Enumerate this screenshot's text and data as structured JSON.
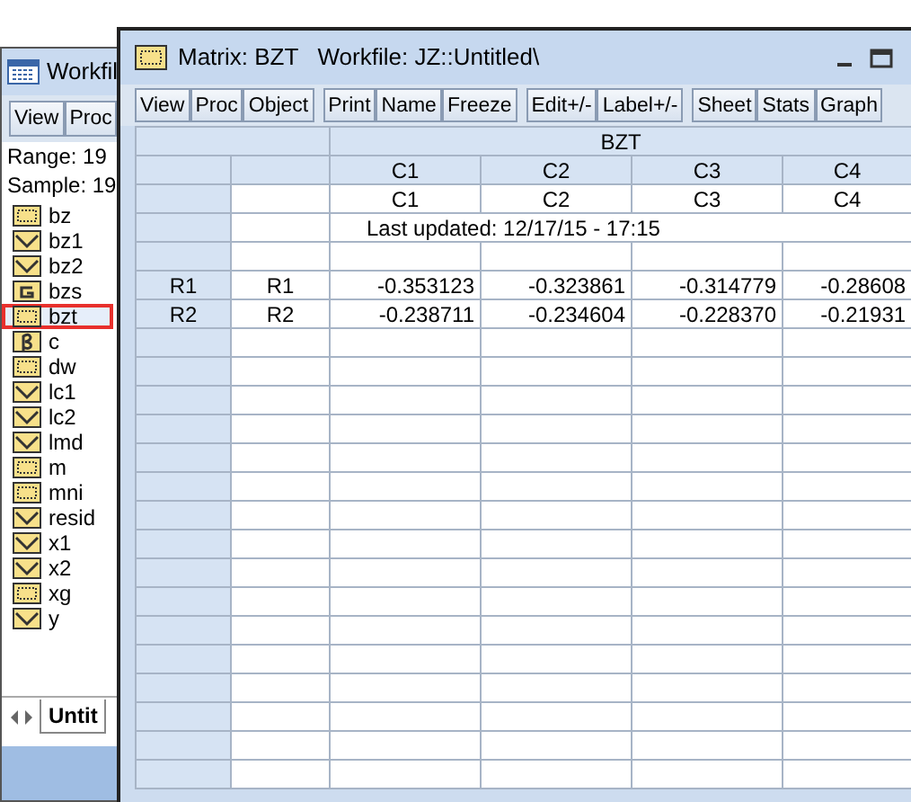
{
  "workfile_window": {
    "title": "Workfil",
    "toolbar": [
      "View",
      "Proc"
    ],
    "range": "Range:  19",
    "sample": "Sample: 19",
    "objects": [
      {
        "name": "bz",
        "kind": "matrix",
        "selected": false
      },
      {
        "name": "bz1",
        "kind": "series",
        "selected": false
      },
      {
        "name": "bz2",
        "kind": "series",
        "selected": false
      },
      {
        "name": "bzs",
        "kind": "group",
        "selected": false
      },
      {
        "name": "bzt",
        "kind": "matrix",
        "selected": true
      },
      {
        "name": "c",
        "kind": "coef",
        "selected": false
      },
      {
        "name": "dw",
        "kind": "matrix",
        "selected": false
      },
      {
        "name": "lc1",
        "kind": "series",
        "selected": false
      },
      {
        "name": "lc2",
        "kind": "series",
        "selected": false
      },
      {
        "name": "lmd",
        "kind": "series",
        "selected": false
      },
      {
        "name": "m",
        "kind": "matrix",
        "selected": false
      },
      {
        "name": "mni",
        "kind": "matrix",
        "selected": false
      },
      {
        "name": "resid",
        "kind": "series",
        "selected": false
      },
      {
        "name": "x1",
        "kind": "series",
        "selected": false
      },
      {
        "name": "x2",
        "kind": "series",
        "selected": false
      },
      {
        "name": "xg",
        "kind": "matrix",
        "selected": false
      },
      {
        "name": "y",
        "kind": "series",
        "selected": false
      }
    ],
    "tab": "Untit"
  },
  "matrix_window": {
    "title": "Matrix: BZT   Workfile: JZ::Untitled\\",
    "toolbar": [
      [
        "View",
        "Proc",
        "Object"
      ],
      [
        "Print",
        "Name",
        "Freeze"
      ],
      [
        "Edit+/-",
        "Label+/-"
      ],
      [
        "Sheet",
        "Stats",
        "Graph"
      ]
    ],
    "table": {
      "title": "BZT",
      "columns": [
        "C1",
        "C2",
        "C3",
        "C4"
      ],
      "labels": [
        "C1",
        "C2",
        "C3",
        "C4"
      ],
      "updated": "Last updated: 12/17/15 - 17:15",
      "rows": [
        {
          "header": "R1",
          "label": "R1",
          "values": [
            "-0.353123",
            "-0.323861",
            "-0.314779",
            "-0.28608"
          ]
        },
        {
          "header": "R2",
          "label": "R2",
          "values": [
            "-0.238711",
            "-0.234604",
            "-0.228370",
            "-0.21931"
          ]
        }
      ]
    }
  }
}
